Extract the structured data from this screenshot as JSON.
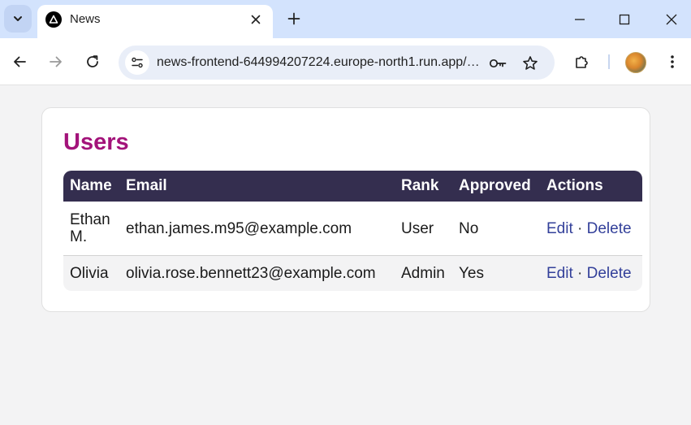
{
  "browser": {
    "tab_title": "News",
    "url": "news-frontend-644994207224.europe-north1.run.app/users"
  },
  "page": {
    "title": "Users"
  },
  "table": {
    "headers": [
      "Name",
      "Email",
      "Rank",
      "Approved",
      "Actions"
    ],
    "rows": [
      {
        "name": "Ethan M.",
        "email": "ethan.james.m95@example.com",
        "rank": "User",
        "approved": "No",
        "edit": "Edit",
        "separator": "·",
        "delete": "Delete"
      },
      {
        "name": "Olivia",
        "email": "olivia.rose.bennett23@example.com",
        "rank": "Admin",
        "approved": "Yes",
        "edit": "Edit",
        "separator": "·",
        "delete": "Delete"
      }
    ]
  },
  "colors": {
    "title": "#a3137a",
    "table_header": "#342e4f",
    "link": "#33409a",
    "tabstrip": "#d3e3fd"
  },
  "icons": [
    "tab-search-icon",
    "favicon-triangle-icon",
    "close-icon",
    "plus-icon",
    "minimize-icon",
    "maximize-icon",
    "back-arrow-icon",
    "forward-arrow-icon",
    "reload-icon",
    "site-settings-icon",
    "key-icon",
    "star-icon",
    "extensions-icon",
    "menu-dots-icon"
  ]
}
